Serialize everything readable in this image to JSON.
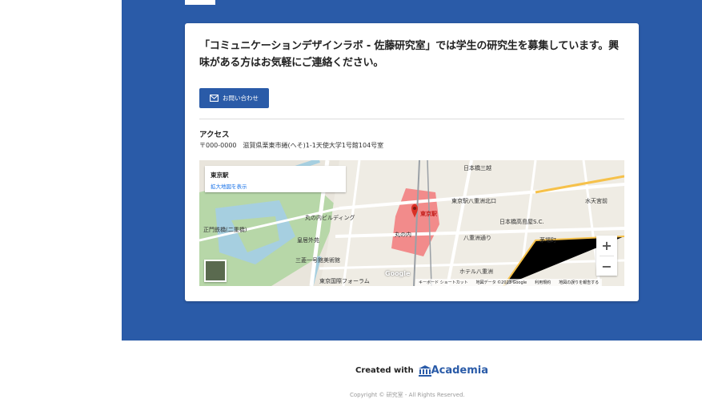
{
  "intro_text": "「コミュニケーションデザインラボ - 佐藤研究室」では学生の研究生を募集しています。興味がある方はお気軽にご連絡ください。",
  "contact_button_label": "お問い合わせ",
  "access": {
    "title": "アクセス",
    "address": "〒000-0000　滋賀県栗東市綣(へそ)1-1天使大学1号館104号室"
  },
  "map": {
    "place_name": "東京駅",
    "larger_map_link": "拡大地図を表示",
    "footer": [
      "キーボード ショートカット",
      "地図データ ©2023 Google",
      "利用規約",
      "地図の誤りを報告する"
    ],
    "google_text": "Google",
    "labels": [
      "東京駅",
      "丸の内",
      "丸の内ビルディング",
      "皇居外苑",
      "東京国際フォーラム",
      "日本橋三越",
      "東京駅八重洲北口",
      "日本橋高島屋S.C.",
      "八重洲通り",
      "ホテル八重洲",
      "正門鉄橋(二重橋)",
      "三菱一号館美術館",
      "水天宮前",
      "茅場町"
    ],
    "zoom_in": "+",
    "zoom_out": "−"
  },
  "footer": {
    "created_with": "Created with",
    "brand": "Academia",
    "copyright": "Copyright © 研究室 - All Rights Reserved."
  }
}
